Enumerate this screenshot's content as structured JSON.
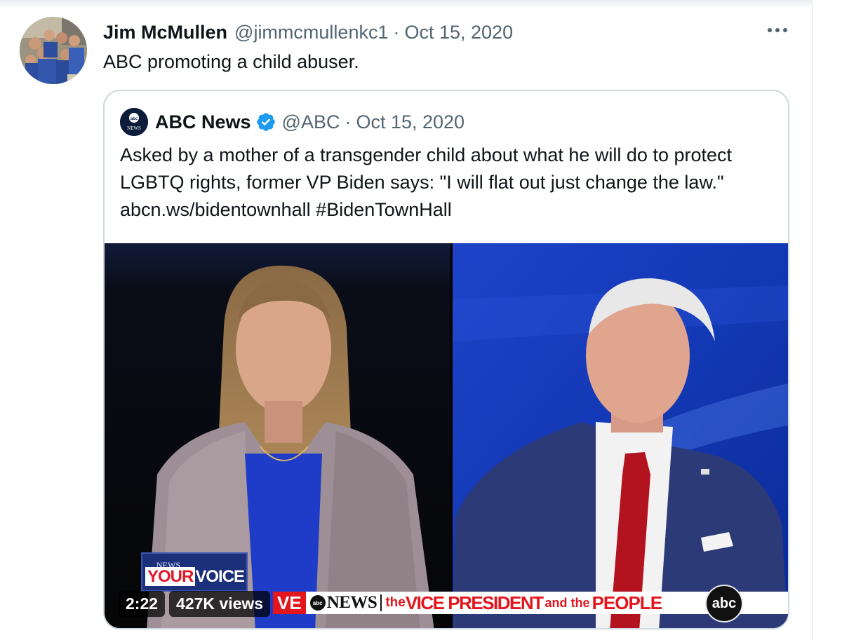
{
  "tweet": {
    "author": {
      "display_name": "Jim McMullen",
      "handle": "@jimmcmullenkc1"
    },
    "separator": "·",
    "timestamp": "Oct 15, 2020",
    "text": "ABC promoting a child abuser.",
    "more_icon": "more-horizontal-icon"
  },
  "quoted_tweet": {
    "author": {
      "display_name": "ABC News",
      "handle": "@ABC",
      "verified": true,
      "avatar_text": "NEWS"
    },
    "separator": "·",
    "timestamp": "Oct 15, 2020",
    "text": "Asked by a mother of a transgender child about what he will do to protect LGBTQ rights, former VP Biden says: \"I will flat out just change the law.\" abcn.ws/bidentownhall #BidenTownHall",
    "video": {
      "duration": "2:22",
      "views": "427K views",
      "overlay": {
        "your_voice_top": "NEWS",
        "your": "YOUR",
        "voice": "VOICE",
        "ticker_ve": "VE",
        "ticker_logo": "abc",
        "ticker_news": "NEWS",
        "ticker_the": "the",
        "ticker_vp": "VICE PRESIDENT",
        "ticker_and": "and the",
        "ticker_people": "PEOPLE",
        "abc_bug": "abc"
      }
    }
  },
  "colors": {
    "text_primary": "#0f1419",
    "text_secondary": "#536471",
    "verified_blue": "#1d9bf0",
    "card_border": "#cfd9de",
    "ticker_red": "#e3151d"
  }
}
